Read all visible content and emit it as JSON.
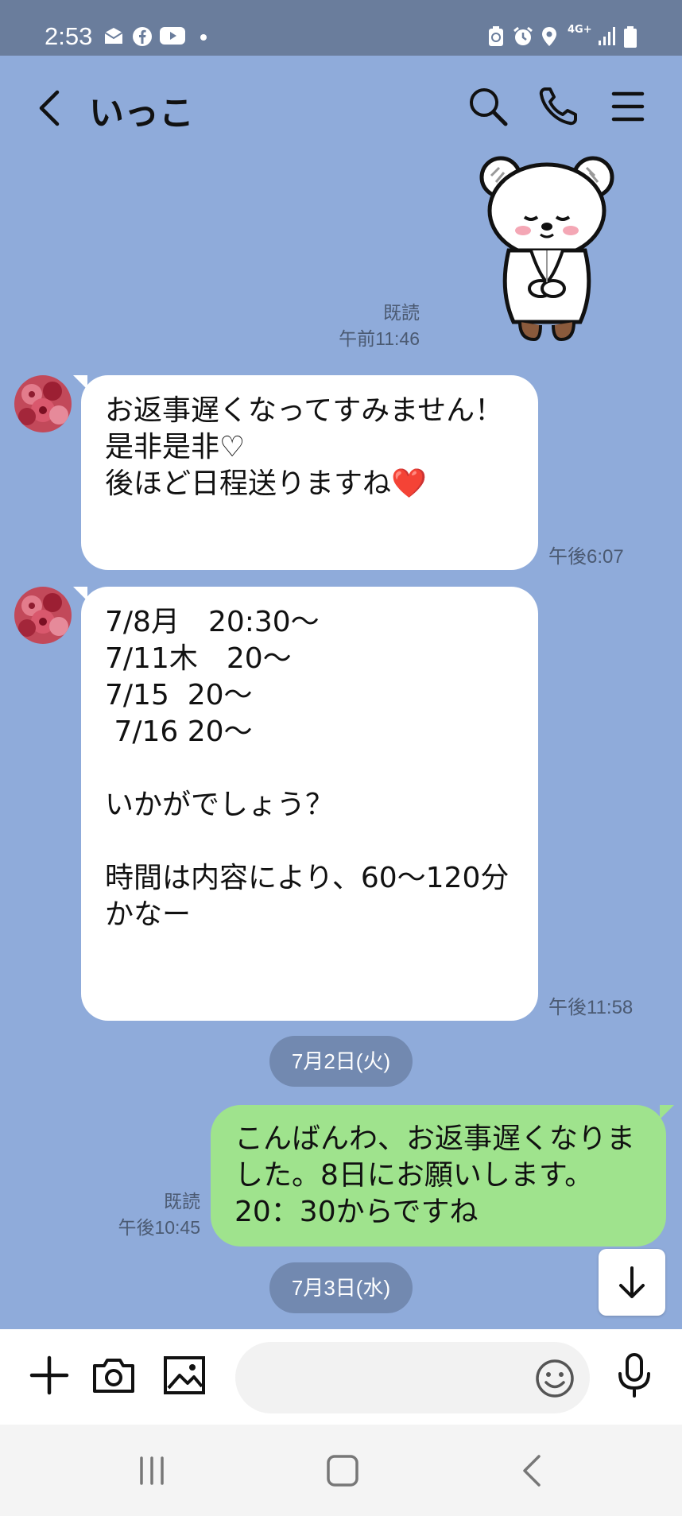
{
  "status_bar": {
    "time": "2:53",
    "network": "4G+"
  },
  "header": {
    "title": "いっこ"
  },
  "messages": {
    "m1": {
      "read": "既読",
      "time": "午前11:46"
    },
    "m2": {
      "text": "お返事遅くなってすみません！\n是非是非♡\n後ほど日程送りますね❤️",
      "time": "午後6:07"
    },
    "m3": {
      "text": "7/8月　20:30〜\n7/11木　20〜\n7/15  20〜\n 7/16 20〜\n\nいかがでしょう？\n\n時間は内容により、60〜120分かなー\n",
      "time": "午後11:58"
    },
    "date1": "7月2日(火)",
    "m4": {
      "text": "こんばんわ、お返事遅くなりました。8日にお願いします。20：30からですね",
      "read": "既読",
      "time": "午後10:45"
    },
    "date2": "7月3日(水)"
  },
  "input": {
    "placeholder": ""
  },
  "icons": [
    "back-icon",
    "search-icon",
    "phone-icon",
    "menu-icon",
    "plus-icon",
    "camera-icon",
    "image-icon",
    "emoji-icon",
    "microphone-icon",
    "arrow-down-icon",
    "recents-icon",
    "home-icon",
    "nav-back-icon"
  ],
  "colors": {
    "background": "#8fabda",
    "outgoing": "#9fe38d",
    "incoming": "#ffffff",
    "date_pill": "#7289b0"
  }
}
